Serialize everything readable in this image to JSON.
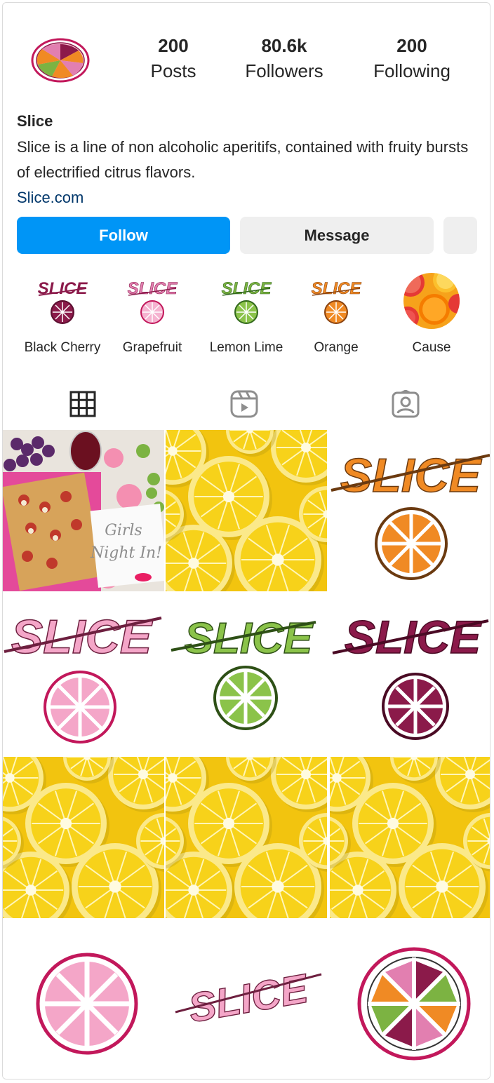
{
  "profile": {
    "name": "Slice",
    "bio": "Slice is a line of non alcoholic aperitifs, contained with fruity bursts of electrified citrus flavors.",
    "link": "Slice.com"
  },
  "stats": {
    "posts_count": "200",
    "posts_label": "Posts",
    "followers_count": "80.6k",
    "followers_label": "Followers",
    "following_count": "200",
    "following_label": "Following"
  },
  "actions": {
    "follow_label": "Follow",
    "message_label": "Message"
  },
  "highlights": [
    {
      "label": "Black Cherry",
      "color": "#8b1a4a"
    },
    {
      "label": "Grapefruit",
      "color": "#e27fb0"
    },
    {
      "label": "Lemon Lime",
      "color": "#7cb342"
    },
    {
      "label": "Orange",
      "color": "#f08a24"
    },
    {
      "label": "Cause",
      "color": "#f4a21d"
    }
  ],
  "tabs": [
    {
      "name": "posts",
      "icon": "grid-icon"
    },
    {
      "name": "reels",
      "icon": "reels-icon"
    },
    {
      "name": "tagged",
      "icon": "tagged-user-icon"
    }
  ],
  "post_overlay_text": {
    "slice_logo": "SLICE",
    "girls_night": "Girls Night In!"
  },
  "colors": {
    "accent": "#0095f6",
    "link": "#00376b",
    "black_cherry": "#8b1a4a",
    "grapefruit": "#e27fb0",
    "lemon_lime": "#7cb342",
    "orange": "#f08a24",
    "lemon": "#f7d21a"
  }
}
